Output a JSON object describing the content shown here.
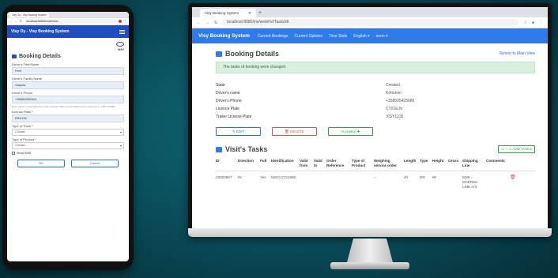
{
  "phone": {
    "tab_title": "Visy Oy - Visy Booking System",
    "url": "localhost:8080/ins/web#/vi...",
    "header_title": "Visy Oy - Visy Booking System",
    "logo_text": "VISY",
    "page_title": "Booking Details",
    "fields": [
      {
        "label": "Driver's First Name",
        "value": "Ferri"
      },
      {
        "label": "Driver's Family Name",
        "value": "Saipola"
      },
      {
        "label": "Driver's Phone",
        "value": "+35850000364"
      }
    ],
    "phone_help": "Enter phone in international format to accept SMS communication from system (e.g. +358 123456)",
    "license_label": "License Plate *",
    "license_value": "ERA190",
    "truck_label": "Type of Truck *",
    "truck_value": "Choose...",
    "product_label": "Type of Product *",
    "product_value": "Choose...",
    "send_sms_label": "Send SMS",
    "ok_label": "OK",
    "cancel_label": "Cancel"
  },
  "desktop": {
    "tab_title": "Visy Booking System",
    "url": "localhost:8080/ins/web#/vi/Tasks/dt",
    "nav": {
      "brand": "Visy Booking System",
      "items": [
        "Current Bookings",
        "Current Options",
        "Time Slots",
        "English ▾",
        "anon ▾"
      ]
    },
    "page_title": "Booking Details",
    "return_link": "Return to Main View",
    "alert": "The tasks of booking were changed.",
    "details": [
      {
        "label": "State",
        "value": "Created"
      },
      {
        "label": "Driver's name",
        "value": "Kettunen"
      },
      {
        "label": "Driver's Phone",
        "value": "+358505425680"
      },
      {
        "label": "Licence Plate",
        "value": "CT01EJV"
      },
      {
        "label": "Trailer License Plate",
        "value": "VISY1235"
      }
    ],
    "buttons": {
      "edit": "✎ EDIT",
      "delete": "🗑 DELETE",
      "accept": "Accepted ✚"
    },
    "tasks_title": "Visit's Tasks",
    "add_tasks": "▭ + ▭ ADD TASKS",
    "table": {
      "headers": [
        "ID",
        "Direction",
        "Full",
        "Identification",
        "Valid from",
        "Valid to",
        "Order Reference",
        "Type of Product",
        "Weighing service order",
        "Length",
        "Type",
        "Height",
        "Gross",
        "Shipping Line",
        "Comments",
        ""
      ],
      "rows": [
        [
          "23003857",
          "IN",
          "Yes",
          "MSCU7211988",
          "",
          "",
          "",
          "",
          "--",
          "40",
          "DR",
          "90",
          "",
          "MSK - MAERSK LINE A/S",
          "",
          ""
        ]
      ]
    }
  }
}
